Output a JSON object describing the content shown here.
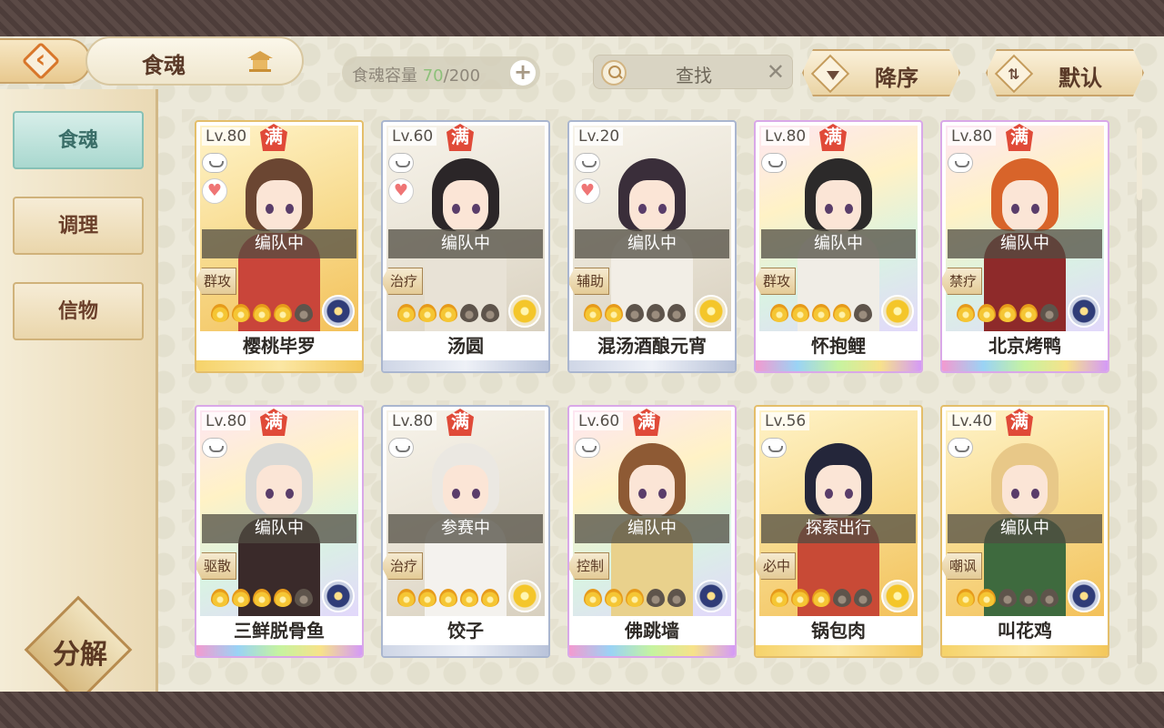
{
  "header": {
    "title": "食魂",
    "capacity_label": "食魂容量",
    "capacity_current": "70",
    "capacity_max": "/200",
    "search_label": "查找",
    "sort_desc_label": "降序",
    "sort_default_label": "默认"
  },
  "sidebar": {
    "tabs": [
      {
        "label": "食魂",
        "active": true
      },
      {
        "label": "调理",
        "active": false
      },
      {
        "label": "信物",
        "active": false
      }
    ],
    "decompose_label": "分解"
  },
  "cards": [
    {
      "level": "Lv.80",
      "full": "满",
      "heart": true,
      "status": "编队中",
      "role": "群攻",
      "flames_on": 4,
      "element": "navy",
      "name": "樱桃毕罗",
      "rarity": "gold",
      "hair": "#6b4632",
      "outfit": "#c9453a"
    },
    {
      "level": "Lv.60",
      "full": "满",
      "heart": true,
      "status": "编队中",
      "role": "治疗",
      "flames_on": 3,
      "element": "gold",
      "name": "汤圆",
      "rarity": "silver",
      "hair": "#2b2628",
      "outfit": "#e8e2d6"
    },
    {
      "level": "Lv.20",
      "full": "",
      "heart": true,
      "status": "编队中",
      "role": "辅助",
      "flames_on": 2,
      "element": "gold",
      "name": "混汤酒酿元宵",
      "rarity": "silver",
      "hair": "#3a2e3a",
      "outfit": "#f2eee6"
    },
    {
      "level": "Lv.80",
      "full": "满",
      "heart": false,
      "status": "编队中",
      "role": "群攻",
      "flames_on": 4,
      "element": "gold",
      "name": "怀抱鲤",
      "rarity": "rainbow",
      "hair": "#2c2a2a",
      "outfit": "#f0ede6"
    },
    {
      "level": "Lv.80",
      "full": "满",
      "heart": false,
      "status": "编队中",
      "role": "禁疗",
      "flames_on": 4,
      "element": "navy",
      "name": "北京烤鸭",
      "rarity": "rainbow",
      "hair": "#d8642a",
      "outfit": "#8e2a2a"
    },
    {
      "level": "Lv.80",
      "full": "满",
      "heart": false,
      "status": "编队中",
      "role": "驱散",
      "flames_on": 4,
      "element": "navy",
      "name": "三鲜脱骨鱼",
      "rarity": "rainbow",
      "hair": "#d9d9d6",
      "outfit": "#3a2a2a"
    },
    {
      "level": "Lv.80",
      "full": "满",
      "heart": false,
      "status": "参赛中",
      "role": "治疗",
      "flames_on": 5,
      "element": "gold",
      "name": "饺子",
      "rarity": "silver",
      "hair": "#ebe8e2",
      "outfit": "#f4f2ee"
    },
    {
      "level": "Lv.60",
      "full": "满",
      "heart": false,
      "status": "编队中",
      "role": "控制",
      "flames_on": 3,
      "element": "navy",
      "name": "佛跳墙",
      "rarity": "rainbow",
      "hair": "#8e5a34",
      "outfit": "#e9d18c"
    },
    {
      "level": "Lv.56",
      "full": "",
      "heart": false,
      "status": "探索出行",
      "role": "必中",
      "flames_on": 3,
      "element": "gold",
      "name": "锅包肉",
      "rarity": "gold",
      "hair": "#24263a",
      "outfit": "#c84a36"
    },
    {
      "level": "Lv.40",
      "full": "满",
      "heart": false,
      "status": "编队中",
      "role": "嘲讽",
      "flames_on": 2,
      "element": "navy",
      "name": "叫花鸡",
      "rarity": "gold",
      "hair": "#e8c888",
      "outfit": "#3e6a3e"
    }
  ],
  "colors": {
    "accent_teal": "#a9d8cf",
    "full_badge_red": "#e04a38",
    "capacity_green": "#8dc07a"
  }
}
